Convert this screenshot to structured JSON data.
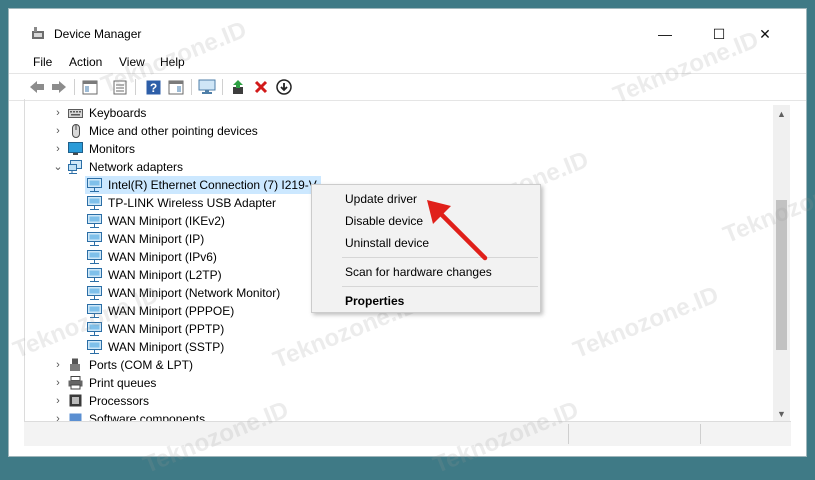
{
  "window": {
    "title": "Device Manager",
    "minimize_glyph": "—",
    "maximize_glyph": "☐",
    "close_glyph": "✕"
  },
  "menu": [
    "File",
    "Action",
    "View",
    "Help"
  ],
  "toolbar": {
    "icons": [
      "back-icon",
      "forward-icon",
      "show-hide-console-tree-icon",
      "properties-icon",
      "help-icon",
      "show-action-pane-icon",
      "scan-hardware-icon",
      "update-driver-icon",
      "uninstall-icon",
      "download-driver-icon"
    ]
  },
  "tree": {
    "categories_above": [
      {
        "label": "Keyboards",
        "icon": "keyboard-icon"
      },
      {
        "label": "Mice and other pointing devices",
        "icon": "mouse-icon"
      },
      {
        "label": "Monitors",
        "icon": "monitor-icon"
      }
    ],
    "expanded": {
      "label": "Network adapters",
      "icon": "network-icon",
      "children": [
        "Intel(R) Ethernet Connection (7) I219-V",
        "TP-LINK Wireless USB Adapter",
        "WAN Miniport (IKEv2)",
        "WAN Miniport (IP)",
        "WAN Miniport (IPv6)",
        "WAN Miniport (L2TP)",
        "WAN Miniport (Network Monitor)",
        "WAN Miniport (PPPOE)",
        "WAN Miniport (PPTP)",
        "WAN Miniport (SSTP)"
      ]
    },
    "categories_below": [
      {
        "label": "Ports (COM & LPT)",
        "icon": "port-icon"
      },
      {
        "label": "Print queues",
        "icon": "printer-icon"
      },
      {
        "label": "Processors",
        "icon": "processor-icon"
      },
      {
        "label": "Software components",
        "icon": "software-icon"
      }
    ],
    "chevron_collapsed": "›",
    "chevron_expanded": "⌄"
  },
  "context_menu": {
    "items": [
      "Update driver",
      "Disable device",
      "Uninstall device"
    ],
    "scan": "Scan for hardware changes",
    "properties": "Properties"
  },
  "watermark": "Teknozone.ID",
  "colors": {
    "selection": "#cce8ff",
    "arrow": "#e0201a",
    "frame": "#3f7a86"
  }
}
